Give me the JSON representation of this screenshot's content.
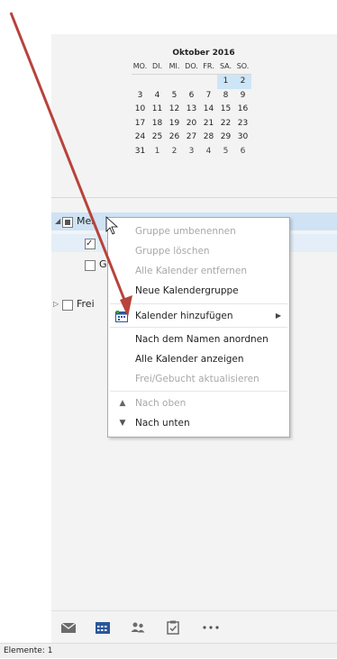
{
  "calendar": {
    "month_title": "Oktober 2016",
    "weekdays": [
      "MO.",
      "DI.",
      "MI.",
      "DO.",
      "FR.",
      "SA.",
      "SO."
    ],
    "days": [
      "",
      "",
      "",
      "",
      "",
      "1",
      "2",
      "3",
      "4",
      "5",
      "6",
      "7",
      "8",
      "9",
      "10",
      "11",
      "12",
      "13",
      "14",
      "15",
      "16",
      "17",
      "18",
      "19",
      "20",
      "21",
      "22",
      "23",
      "24",
      "25",
      "26",
      "27",
      "28",
      "29",
      "30",
      "31",
      "1",
      "2",
      "3",
      "4",
      "5",
      "6"
    ]
  },
  "tree": {
    "group1_label": "Mei",
    "group2_label": "Frei",
    "item2_label": "G"
  },
  "context_menu": {
    "items": [
      {
        "label": "Gruppe umbenennen"
      },
      {
        "label": "Gruppe löschen"
      },
      {
        "label": "Alle Kalender entfernen"
      },
      {
        "label": "Neue Kalendergruppe"
      },
      {
        "label": "Kalender hinzufügen"
      },
      {
        "label": "Nach dem Namen anordnen"
      },
      {
        "label": "Alle Kalender anzeigen"
      },
      {
        "label": "Frei/Gebucht aktualisieren"
      },
      {
        "label": "Nach oben"
      },
      {
        "label": "Nach unten"
      }
    ]
  },
  "nav": {
    "icons": [
      "mail-icon",
      "calendar-icon",
      "people-icon",
      "tasks-icon",
      "more-icon"
    ]
  },
  "status": {
    "text": "Elemente: 1"
  },
  "colors": {
    "accent": "#2b579a",
    "selection": "#cde6f7",
    "arrow": "#b7433b"
  }
}
